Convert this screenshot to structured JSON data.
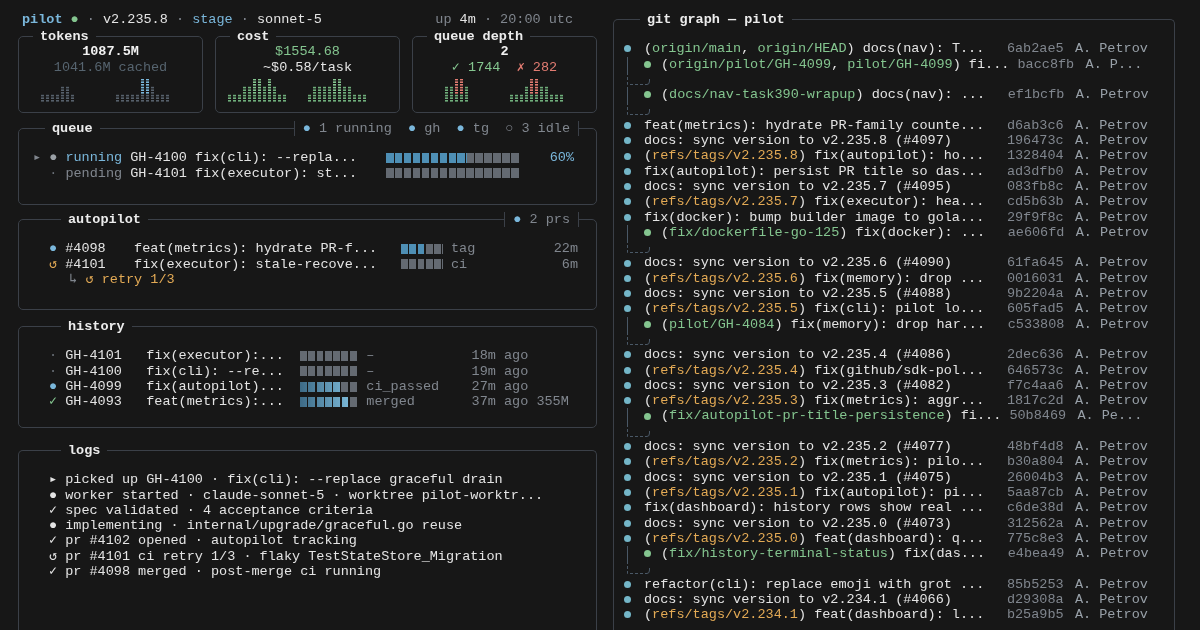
{
  "header": {
    "left": [
      {
        "text": "pilot",
        "kind": "app"
      },
      {
        "text": "●",
        "kind": "green"
      },
      {
        "text": "·",
        "kind": "dim"
      },
      {
        "text": "v2.235.8",
        "kind": "plain"
      },
      {
        "text": "·",
        "kind": "dim"
      },
      {
        "text": "stage",
        "kind": "blue"
      },
      {
        "text": "·",
        "kind": "dim"
      },
      {
        "text": "sonnet-5",
        "kind": "plain"
      }
    ],
    "right": [
      {
        "text": "up",
        "kind": "dim"
      },
      {
        "text": "4m",
        "kind": "plain"
      },
      {
        "text": "·",
        "kind": "dim"
      },
      {
        "text": "20:00 utc",
        "kind": "dim"
      }
    ]
  },
  "cards": [
    {
      "kind": "tokens",
      "title": "tokens",
      "value": "1087.5M",
      "sub": [
        {
          "text": "1041.6M cached",
          "kind": "muted"
        }
      ]
    },
    {
      "kind": "cost",
      "title": "cost",
      "value": "$1554.68",
      "sub": [
        {
          "text": "~$0.58/task",
          "kind": "plain"
        }
      ]
    },
    {
      "kind": "depth",
      "title": "queue depth",
      "value": "2",
      "sub": [
        {
          "text": "✓ 1744",
          "kind": "green"
        },
        {
          "text": "✗ 282",
          "kind": "red"
        }
      ]
    }
  ],
  "queue": {
    "title": "queue",
    "legend": [
      {
        "text": "●",
        "kind": "blue"
      },
      {
        "text": "1 running",
        "kind": "dim"
      },
      {
        "text": "●",
        "kind": "blue"
      },
      {
        "text": "gh",
        "kind": "dim"
      },
      {
        "text": "●",
        "kind": "blue"
      },
      {
        "text": "tg",
        "kind": "dim"
      },
      {
        "text": "○",
        "kind": "dim"
      },
      {
        "text": "3 idle",
        "kind": "dim"
      }
    ],
    "rows": [
      {
        "kind": "running",
        "caret": "▸",
        "icon": "●",
        "status": "running",
        "task": "GH-4100 fix(cli): --repla...",
        "level": 0.6,
        "percent": "60%"
      },
      {
        "kind": "pending",
        "icon": "·",
        "status": "pending",
        "task": "GH-4101 fix(executor): st...",
        "level": 0
      }
    ]
  },
  "autopilot": {
    "title": "autopilot",
    "legend": [
      {
        "text": "●",
        "kind": "blue"
      },
      {
        "text": "2 prs",
        "kind": "dim"
      }
    ],
    "rows": [
      {
        "kind": "active",
        "icon": "●",
        "pr": "#4098",
        "title": "feat(metrics): hydrate PR-f...",
        "level": 0.6,
        "stage": "tag",
        "age": "22m"
      },
      {
        "kind": "retrying",
        "icon": "↺",
        "pr": "#4101",
        "title": "fix(executor): stale-recove...",
        "level": 0,
        "stage": "ci",
        "age": "6m",
        "retry": [
          {
            "text": "↳",
            "kind": "dim"
          },
          {
            "text": "↺ retry 1/3",
            "kind": "orange"
          }
        ]
      }
    ]
  },
  "history": {
    "title": "history",
    "rows": [
      {
        "kind": "idle",
        "icon": "·",
        "id": "GH-4101",
        "title": "fix(executor):...",
        "level": 0,
        "status": "–",
        "age": "18m ago"
      },
      {
        "kind": "idle",
        "icon": "·",
        "id": "GH-4100",
        "title": "fix(cli): --re...",
        "level": 0,
        "status": "–",
        "age": "19m ago"
      },
      {
        "kind": "passed",
        "icon": "●",
        "id": "GH-4099",
        "title": "fix(autopilot)...",
        "level": 0.71,
        "status": "ci_passed",
        "age": "27m ago"
      },
      {
        "kind": "merged",
        "icon": "✓",
        "id": "GH-4093",
        "title": "feat(metrics):...",
        "level": 0.86,
        "status": "merged",
        "age": "37m ago",
        "tokens": "355M"
      }
    ]
  },
  "logs": {
    "title": "logs",
    "lines": [
      {
        "icon": "▸",
        "text": "picked up GH-4100 · fix(cli): --replace graceful drain"
      },
      {
        "icon": "●",
        "text": "worker started · claude-sonnet-5 · worktree pilot-worktr..."
      },
      {
        "icon": "✓",
        "text": "spec validated · 4 acceptance criteria"
      },
      {
        "icon": "●",
        "text": "implementing · internal/upgrade/graceful.go reuse"
      },
      {
        "icon": "✓",
        "text": "pr #4102 opened · autopilot tracking"
      },
      {
        "icon": "↺",
        "text": "pr #4101 ci retry 1/3 · flaky TestStateStore_Migration"
      },
      {
        "icon": "✓",
        "text": "pr #4098 merged · post-merge ci running"
      }
    ]
  },
  "git": {
    "title": "git graph — pilot",
    "rows": [
      {
        "kind": "main",
        "message": [
          {
            "text": "(",
            "kind": "plain"
          },
          {
            "text": "origin/main",
            "kind": "ref"
          },
          {
            "text": ", ",
            "kind": "plain"
          },
          {
            "text": "origin/HEAD",
            "kind": "ref"
          },
          {
            "text": ") docs(nav): T...",
            "kind": "plain"
          }
        ],
        "hash": "6ab2ae5",
        "author": "A. Petrov"
      },
      {
        "kind": "branch",
        "message": [
          {
            "text": "(",
            "kind": "plain"
          },
          {
            "text": "origin/pilot/GH-4099",
            "kind": "ref"
          },
          {
            "text": ", ",
            "kind": "plain"
          },
          {
            "text": "pilot/GH-4099",
            "kind": "ref"
          },
          {
            "text": ") fi...",
            "kind": "plain"
          }
        ],
        "hash": "bacc8fb",
        "author": "A. P..."
      },
      {
        "kind": "merge"
      },
      {
        "kind": "branch",
        "message": [
          {
            "text": "(",
            "kind": "plain"
          },
          {
            "text": "docs/nav-task390-wrapup",
            "kind": "ref"
          },
          {
            "text": ") docs(nav): ...",
            "kind": "plain"
          }
        ],
        "hash": "ef1bcfb",
        "author": "A. Petrov"
      },
      {
        "kind": "merge"
      },
      {
        "kind": "main",
        "message": [
          {
            "text": "feat(metrics): hydrate PR-family counte...",
            "kind": "plain"
          }
        ],
        "hash": "d6ab3c6",
        "author": "A. Petrov"
      },
      {
        "kind": "main",
        "message": [
          {
            "text": "docs: sync version to v2.235.8 (#4097)",
            "kind": "plain"
          }
        ],
        "hash": "196473c",
        "author": "A. Petrov"
      },
      {
        "kind": "main",
        "message": [
          {
            "text": "(",
            "kind": "plain"
          },
          {
            "text": "refs/tags/v2.235.8",
            "kind": "tag"
          },
          {
            "text": ") fix(autopilot): ho...",
            "kind": "plain"
          }
        ],
        "hash": "1328404",
        "author": "A. Petrov"
      },
      {
        "kind": "main",
        "message": [
          {
            "text": "fix(autopilot): persist PR title so das...",
            "kind": "plain"
          }
        ],
        "hash": "ad3dfb0",
        "author": "A. Petrov"
      },
      {
        "kind": "main",
        "message": [
          {
            "text": "docs: sync version to v2.235.7 (#4095)",
            "kind": "plain"
          }
        ],
        "hash": "083fb8c",
        "author": "A. Petrov"
      },
      {
        "kind": "main",
        "message": [
          {
            "text": "(",
            "kind": "plain"
          },
          {
            "text": "refs/tags/v2.235.7",
            "kind": "tag"
          },
          {
            "text": ") fix(executor): hea...",
            "kind": "plain"
          }
        ],
        "hash": "cd5b63b",
        "author": "A. Petrov"
      },
      {
        "kind": "main",
        "message": [
          {
            "text": "fix(docker): bump builder image to gola...",
            "kind": "plain"
          }
        ],
        "hash": "29f9f8c",
        "author": "A. Petrov"
      },
      {
        "kind": "branch",
        "message": [
          {
            "text": "(",
            "kind": "plain"
          },
          {
            "text": "fix/dockerfile-go-125",
            "kind": "ref"
          },
          {
            "text": ") fix(docker): ...",
            "kind": "plain"
          }
        ],
        "hash": "ae606fd",
        "author": "A. Petrov"
      },
      {
        "kind": "merge"
      },
      {
        "kind": "main",
        "message": [
          {
            "text": "docs: sync version to v2.235.6 (#4090)",
            "kind": "plain"
          }
        ],
        "hash": "61fa645",
        "author": "A. Petrov"
      },
      {
        "kind": "main",
        "message": [
          {
            "text": "(",
            "kind": "plain"
          },
          {
            "text": "refs/tags/v2.235.6",
            "kind": "tag"
          },
          {
            "text": ") fix(memory): drop ...",
            "kind": "plain"
          }
        ],
        "hash": "0016031",
        "author": "A. Petrov"
      },
      {
        "kind": "main",
        "message": [
          {
            "text": "docs: sync version to v2.235.5 (#4088)",
            "kind": "plain"
          }
        ],
        "hash": "9b2204a",
        "author": "A. Petrov"
      },
      {
        "kind": "main",
        "message": [
          {
            "text": "(",
            "kind": "plain"
          },
          {
            "text": "refs/tags/v2.235.5",
            "kind": "tag"
          },
          {
            "text": ") fix(cli): pilot lo...",
            "kind": "plain"
          }
        ],
        "hash": "605fad5",
        "author": "A. Petrov"
      },
      {
        "kind": "branch",
        "message": [
          {
            "text": "(",
            "kind": "plain"
          },
          {
            "text": "pilot/GH-4084",
            "kind": "ref"
          },
          {
            "text": ") fix(memory): drop har...",
            "kind": "plain"
          }
        ],
        "hash": "c533808",
        "author": "A. Petrov"
      },
      {
        "kind": "merge"
      },
      {
        "kind": "main",
        "message": [
          {
            "text": "docs: sync version to v2.235.4 (#4086)",
            "kind": "plain"
          }
        ],
        "hash": "2dec636",
        "author": "A. Petrov"
      },
      {
        "kind": "main",
        "message": [
          {
            "text": "(",
            "kind": "plain"
          },
          {
            "text": "refs/tags/v2.235.4",
            "kind": "tag"
          },
          {
            "text": ") fix(github/sdk-pol...",
            "kind": "plain"
          }
        ],
        "hash": "646573c",
        "author": "A. Petrov"
      },
      {
        "kind": "main",
        "message": [
          {
            "text": "docs: sync version to v2.235.3 (#4082)",
            "kind": "plain"
          }
        ],
        "hash": "f7c4aa6",
        "author": "A. Petrov"
      },
      {
        "kind": "main",
        "message": [
          {
            "text": "(",
            "kind": "plain"
          },
          {
            "text": "refs/tags/v2.235.3",
            "kind": "tag"
          },
          {
            "text": ") fix(metrics): aggr...",
            "kind": "plain"
          }
        ],
        "hash": "1817c2d",
        "author": "A. Petrov"
      },
      {
        "kind": "branch",
        "message": [
          {
            "text": "(",
            "kind": "plain"
          },
          {
            "text": "fix/autopilot-pr-title-persistence",
            "kind": "ref"
          },
          {
            "text": ") fi...",
            "kind": "plain"
          }
        ],
        "hash": "50b8469",
        "author": "A. Pe..."
      },
      {
        "kind": "merge"
      },
      {
        "kind": "main",
        "message": [
          {
            "text": "docs: sync version to v2.235.2 (#4077)",
            "kind": "plain"
          }
        ],
        "hash": "48bf4d8",
        "author": "A. Petrov"
      },
      {
        "kind": "main",
        "message": [
          {
            "text": "(",
            "kind": "plain"
          },
          {
            "text": "refs/tags/v2.235.2",
            "kind": "tag"
          },
          {
            "text": ") fix(metrics): pilo...",
            "kind": "plain"
          }
        ],
        "hash": "b30a804",
        "author": "A. Petrov"
      },
      {
        "kind": "main",
        "message": [
          {
            "text": "docs: sync version to v2.235.1 (#4075)",
            "kind": "plain"
          }
        ],
        "hash": "26004b3",
        "author": "A. Petrov"
      },
      {
        "kind": "main",
        "message": [
          {
            "text": "(",
            "kind": "plain"
          },
          {
            "text": "refs/tags/v2.235.1",
            "kind": "tag"
          },
          {
            "text": ") fix(autopilot): pi...",
            "kind": "plain"
          }
        ],
        "hash": "5aa87cb",
        "author": "A. Petrov"
      },
      {
        "kind": "main",
        "message": [
          {
            "text": "fix(dashboard): history rows show real ...",
            "kind": "plain"
          }
        ],
        "hash": "c6de38d",
        "author": "A. Petrov"
      },
      {
        "kind": "main",
        "message": [
          {
            "text": "docs: sync version to v2.235.0 (#4073)",
            "kind": "plain"
          }
        ],
        "hash": "312562a",
        "author": "A. Petrov"
      },
      {
        "kind": "main",
        "message": [
          {
            "text": "(",
            "kind": "plain"
          },
          {
            "text": "refs/tags/v2.235.0",
            "kind": "tag"
          },
          {
            "text": ") feat(dashboard): q...",
            "kind": "plain"
          }
        ],
        "hash": "775c8e3",
        "author": "A. Petrov"
      },
      {
        "kind": "branch",
        "message": [
          {
            "text": "(",
            "kind": "plain"
          },
          {
            "text": "fix/history-terminal-status",
            "kind": "ref"
          },
          {
            "text": ") fix(das...",
            "kind": "plain"
          }
        ],
        "hash": "e4bea49",
        "author": "A. Petrov"
      },
      {
        "kind": "merge"
      },
      {
        "kind": "main",
        "message": [
          {
            "text": "refactor(cli): replace emoji with grot ...",
            "kind": "plain"
          }
        ],
        "hash": "85b5253",
        "author": "A. Petrov"
      },
      {
        "kind": "main",
        "message": [
          {
            "text": "docs: sync version to v2.234.1 (#4066)",
            "kind": "plain"
          }
        ],
        "hash": "d29308a",
        "author": "A. Petrov"
      },
      {
        "kind": "main",
        "message": [
          {
            "text": "(",
            "kind": "plain"
          },
          {
            "text": "refs/tags/v2.234.1",
            "kind": "tag"
          },
          {
            "text": ") feat(dashboard): l...",
            "kind": "plain"
          }
        ],
        "hash": "b25a9b5",
        "author": "A. Petrov"
      }
    ]
  }
}
